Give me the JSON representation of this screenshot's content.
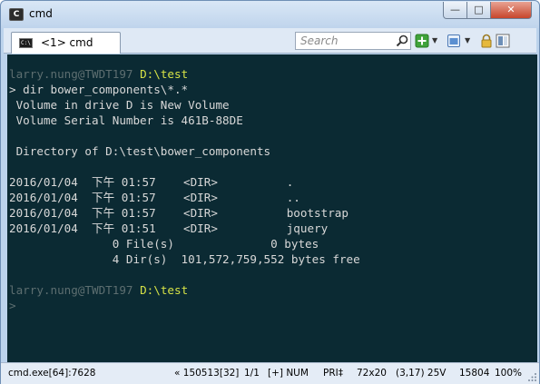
{
  "window": {
    "title": "cmd",
    "app_icon_glyph": "C"
  },
  "window_controls": {
    "minimize": "—",
    "maximize": "□",
    "close": "✕"
  },
  "toolbar": {
    "tab_label": "<1> cmd",
    "tab_icon_glyph": "C:\\",
    "search_placeholder": "Search",
    "icons": [
      "search-icon",
      "new-console-plus-icon",
      "console-view-icon",
      "lock-icon",
      "panel-layout-icon"
    ]
  },
  "console": {
    "lines": [
      {
        "kind": "prompt",
        "user": "larry.nung@TWDT197",
        "path": "D:\\test"
      },
      {
        "kind": "text",
        "text": "> dir bower_components\\*.*"
      },
      {
        "kind": "text",
        "text": " Volume in drive D is New Volume"
      },
      {
        "kind": "text",
        "text": " Volume Serial Number is 461B-88DE"
      },
      {
        "kind": "text",
        "text": ""
      },
      {
        "kind": "text",
        "text": " Directory of D:\\test\\bower_components"
      },
      {
        "kind": "text",
        "text": ""
      },
      {
        "kind": "text",
        "text": "2016/01/04  下午 01:57    <DIR>          ."
      },
      {
        "kind": "text",
        "text": "2016/01/04  下午 01:57    <DIR>          .."
      },
      {
        "kind": "text",
        "text": "2016/01/04  下午 01:57    <DIR>          bootstrap"
      },
      {
        "kind": "text",
        "text": "2016/01/04  下午 01:51    <DIR>          jquery"
      },
      {
        "kind": "text",
        "text": "               0 File(s)              0 bytes"
      },
      {
        "kind": "text",
        "text": "               4 Dir(s)  101,572,759,552 bytes free"
      },
      {
        "kind": "text",
        "text": ""
      },
      {
        "kind": "prompt",
        "user": "larry.nung@TWDT197",
        "path": "D:\\test"
      },
      {
        "kind": "caret",
        "text": ">"
      }
    ]
  },
  "statusbar": {
    "process": "cmd.exe[64]:7628",
    "pid_info": "« 150513[32]",
    "console_index": "1/1",
    "keys": "[+] NUM",
    "priority": "PRI‡",
    "size": "72x20",
    "cursor": "(3,17) 25V",
    "pid": "15804",
    "zoom": "100%"
  },
  "colors": {
    "console_bg": "#0b2a33",
    "console_text": "#d8d8d8",
    "prompt_user": "#5d6e70",
    "prompt_path": "#d6e246",
    "close_button": "#c7452b"
  }
}
